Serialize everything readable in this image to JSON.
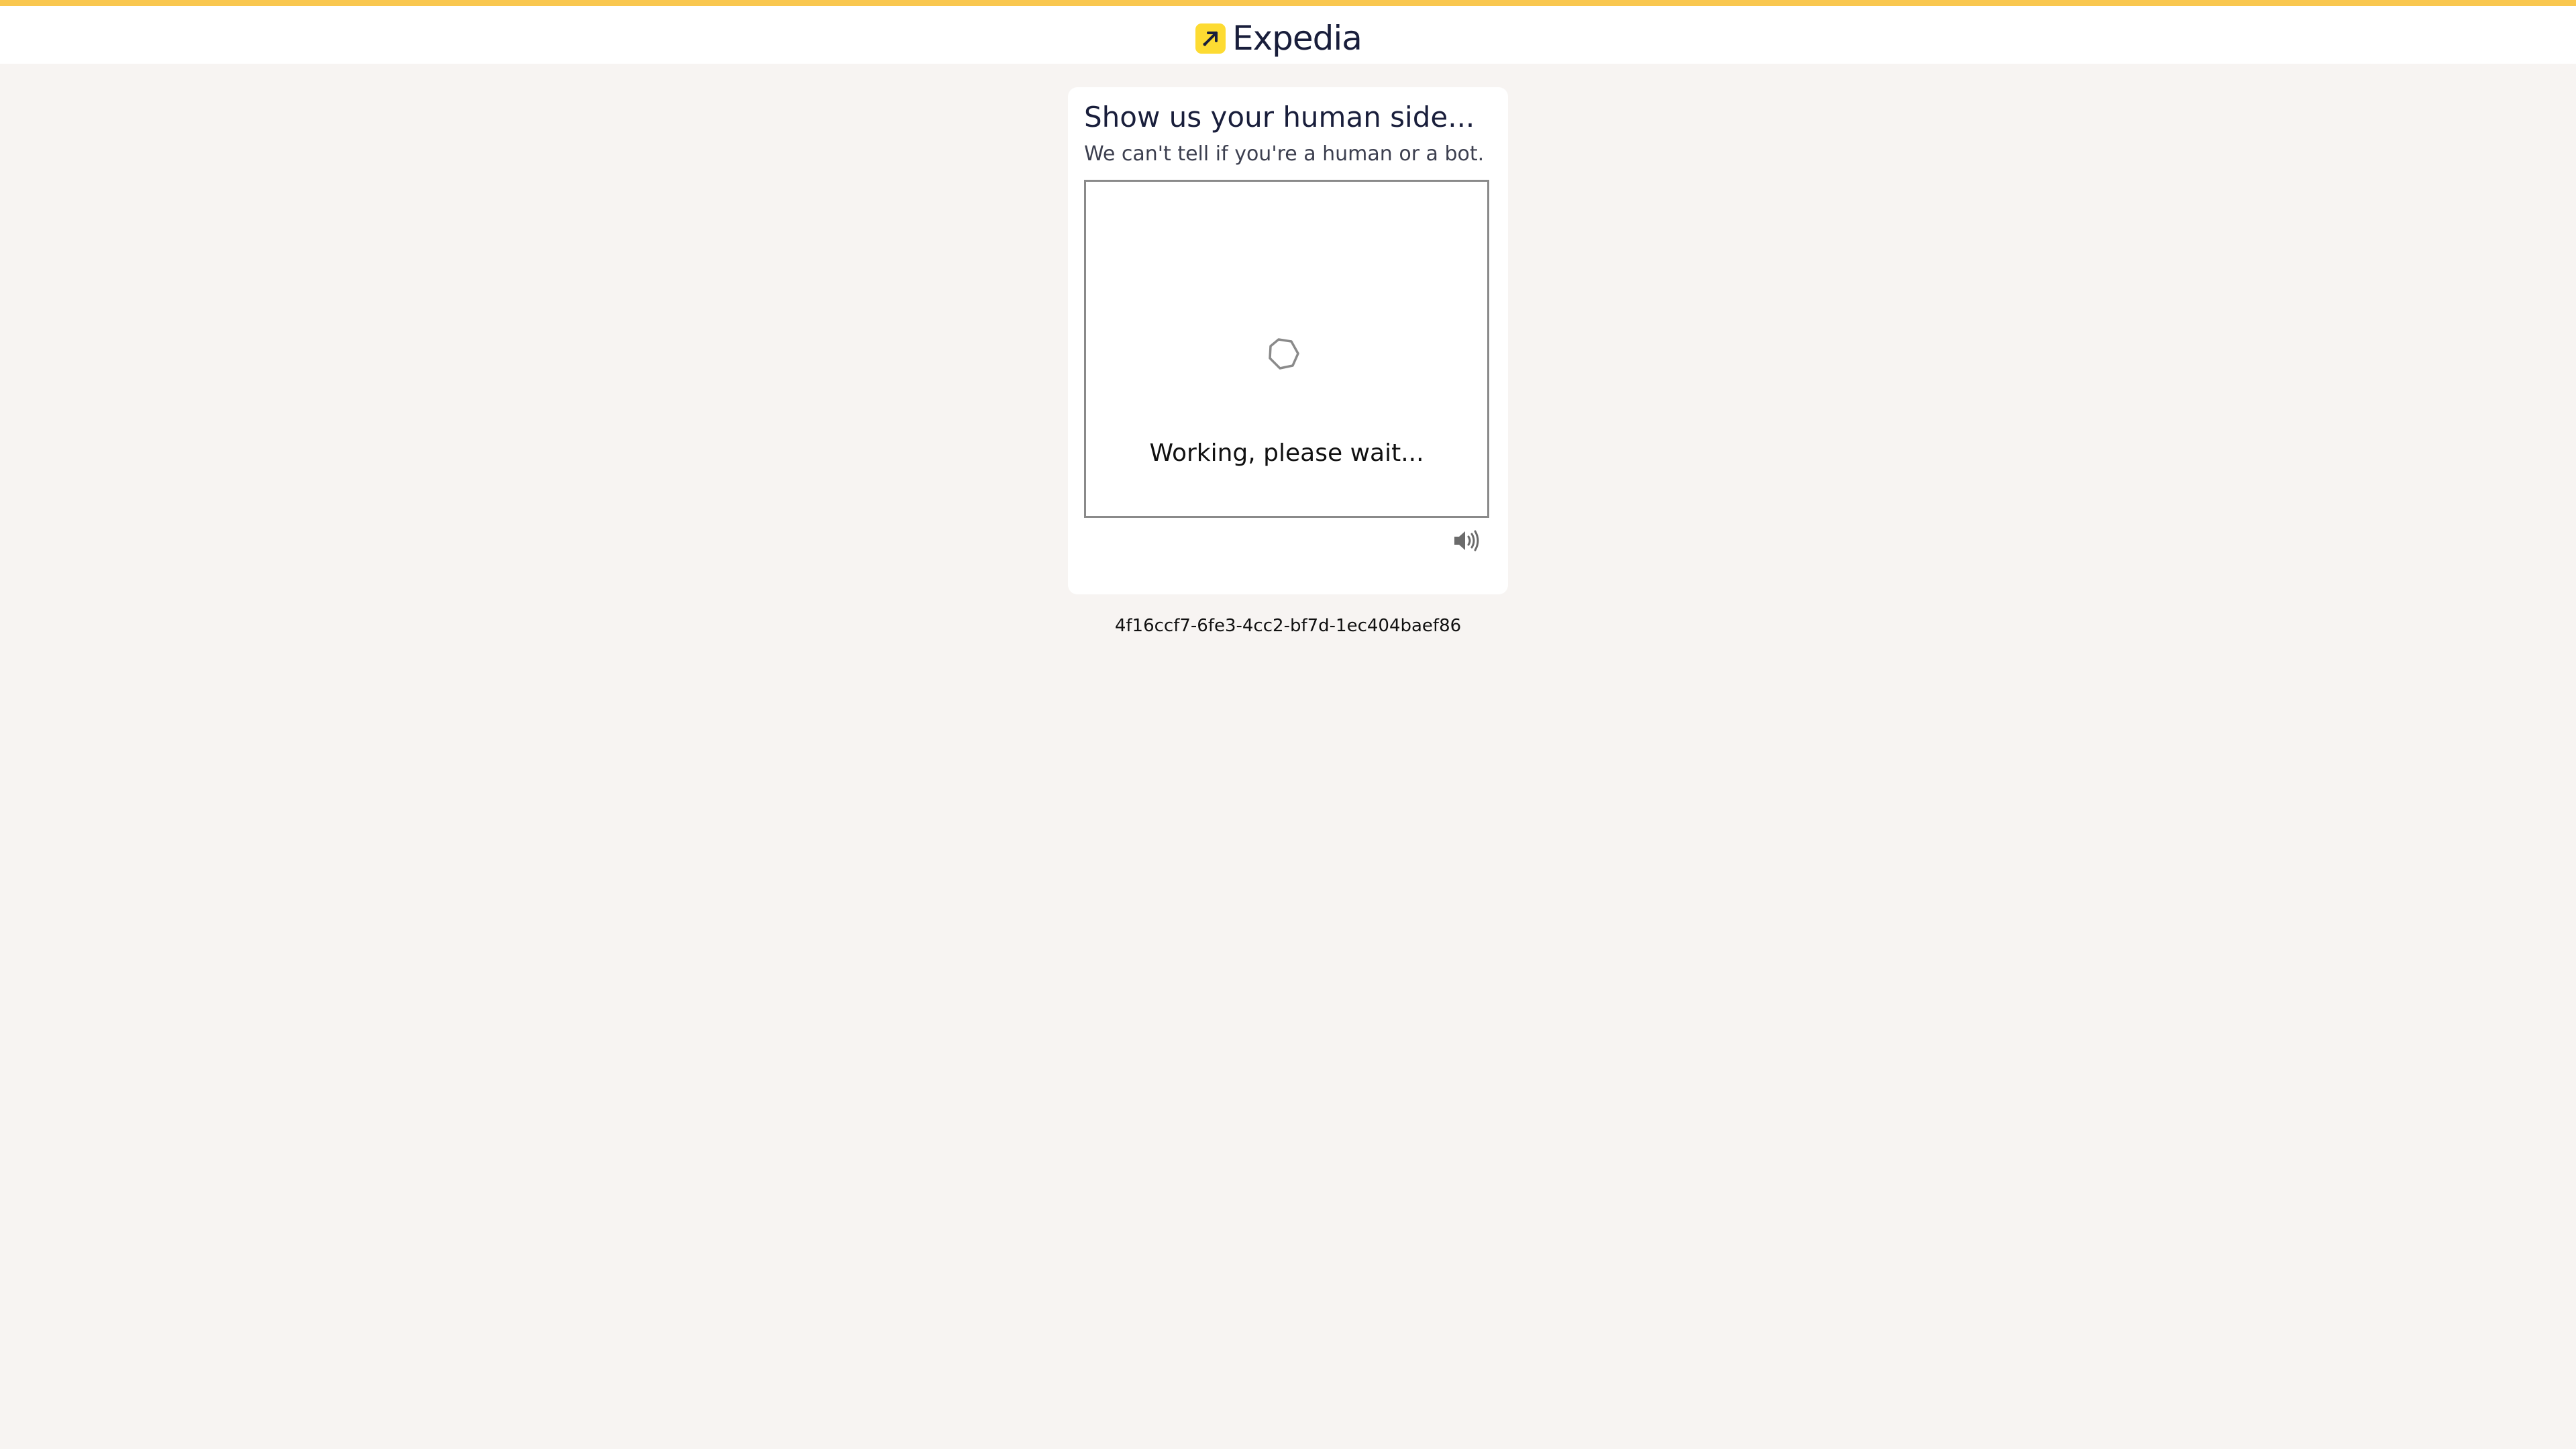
{
  "header": {
    "brand_name": "Expedia",
    "accent_color": "#f9c74f",
    "logo_color": "#fddb32"
  },
  "challenge": {
    "title": "Show us your human side...",
    "subtitle": "We can't tell if you're a human or a bot.",
    "status": "Working, please wait...",
    "spinner_icon": "hexagon-spinner-icon",
    "audio_icon": "speaker-icon"
  },
  "footer": {
    "reference_id": "4f16ccf7-6fe3-4cc2-bf7d-1ec404baef86"
  }
}
